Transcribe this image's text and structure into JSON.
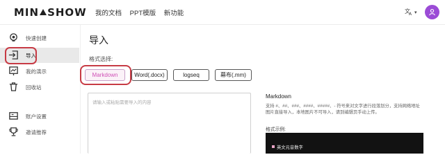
{
  "header": {
    "logo_left": "MIN",
    "logo_right": "SHOW",
    "nav": [
      "我的文档",
      "PPT模版",
      "新功能"
    ],
    "lang_icon": "translate-icon",
    "caret": "▾",
    "avatar_icon": "user-icon"
  },
  "sidebar": {
    "items": [
      {
        "label": "快速创建",
        "icon": "lightbulb-icon"
      },
      {
        "label": "导入",
        "icon": "import-icon"
      },
      {
        "label": "我的演示",
        "icon": "presentation-icon"
      },
      {
        "label": "回收站",
        "icon": "trash-icon"
      },
      {
        "label": "账户设置",
        "icon": "settings-icon"
      },
      {
        "label": "邀请推荐",
        "icon": "trophy-icon"
      }
    ],
    "active_index": 1
  },
  "main": {
    "title": "导入",
    "format_label": "格式选择:",
    "formats": [
      "Markdown",
      "Word(.docx)",
      "logseq",
      "幕布(.mm)"
    ],
    "selected_format": "Markdown",
    "textarea_placeholder": "请输入或粘贴需要导入的内容"
  },
  "help": {
    "title": "Markdown",
    "description": "支持 #、##、###、####、#####、- 符号来对文字进行段落划分，支持网络地址图片直接导入，本地图片不可导入，请到编辑页手动上传。",
    "example_label": "格式示例:",
    "example_line": "英文元音数字"
  },
  "colors": {
    "accent_pink": "#cf4fb6",
    "highlight_red": "#c73a44",
    "avatar_purple": "#9b4bd6"
  }
}
